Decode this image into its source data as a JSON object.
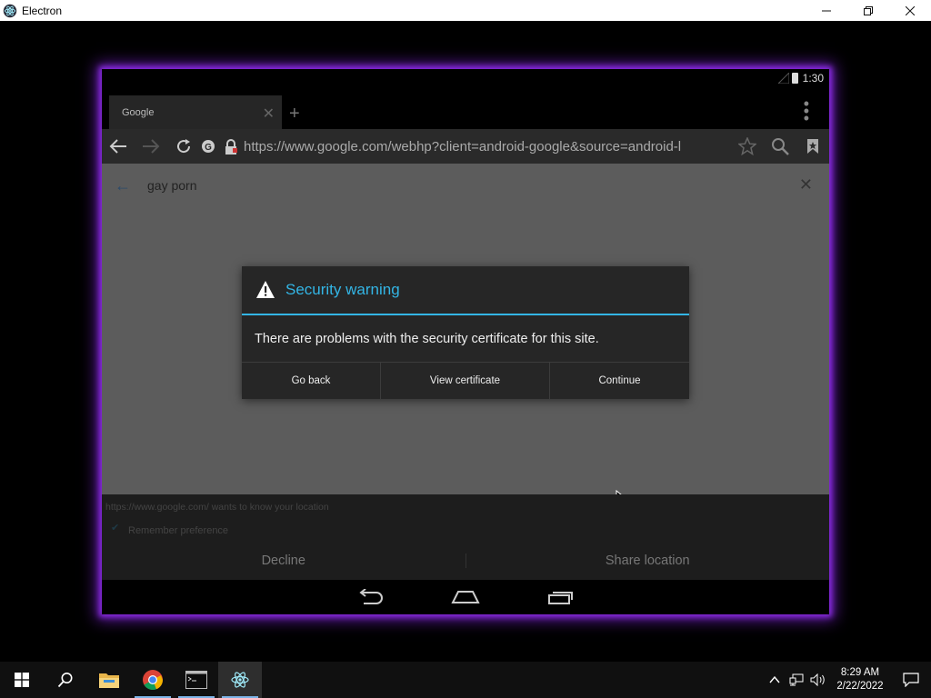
{
  "window": {
    "title": "Electron",
    "controls": {
      "minimize": "—",
      "maximize": "❐",
      "close": "✕"
    }
  },
  "android": {
    "status_time": "1:30",
    "tab": {
      "title": "Google",
      "close": "✕",
      "new_tab": "+"
    },
    "url": "https://www.google.com/webhp?client=android-google&source=android-l",
    "search": {
      "query": "gay porn",
      "clear": "✕",
      "back": "←"
    },
    "dialog": {
      "title": "Security warning",
      "message": "There are problems with the security certificate for this site.",
      "buttons": [
        "Go back",
        "View certificate",
        "Continue"
      ]
    },
    "infobar": {
      "message": "https://www.google.com/ wants to know your location",
      "remember": "Remember preference",
      "checkmark": "✔",
      "decline": "Decline",
      "share": "Share location"
    },
    "accent_color": "#33b5e5"
  },
  "taskbar": {
    "time": "8:29 AM",
    "date": "2/22/2022",
    "apps": [
      "start-icon",
      "search-icon",
      "file-explorer-icon",
      "chrome-icon",
      "terminal-icon",
      "electron-icon"
    ]
  }
}
